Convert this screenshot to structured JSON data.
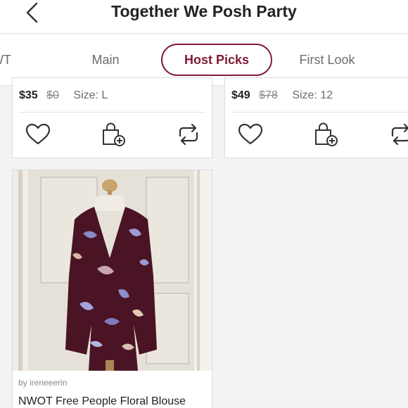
{
  "header": {
    "title": "Together We Posh Party"
  },
  "tabs": [
    {
      "label": "NWT"
    },
    {
      "label": "Main"
    },
    {
      "label": "Host Picks"
    },
    {
      "label": "First Look"
    }
  ],
  "active_tab": "Host Picks",
  "colors": {
    "accent": "#7f1b33",
    "icon": "#333333"
  },
  "listings": [
    {
      "price": "$35",
      "original_price": "$0",
      "size": "Size: L"
    },
    {
      "price": "$49",
      "original_price": "$78",
      "size": "Size: 12"
    },
    {
      "byline": "by ireneeerin",
      "title": "NWOT Free People Floral Blouse"
    }
  ],
  "icons": {
    "back": "chevron-left-icon",
    "like": "heart-icon",
    "bundle": "bag-plus-icon",
    "share": "share-icon"
  }
}
